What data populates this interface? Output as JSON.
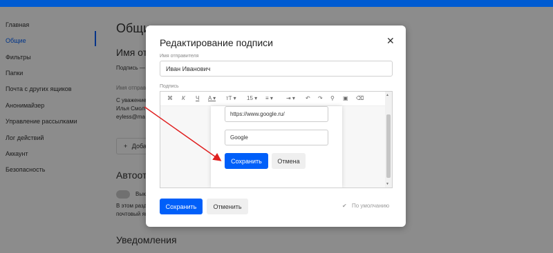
{
  "sidebar": {
    "items": [
      {
        "label": "Главная"
      },
      {
        "label": "Общие"
      },
      {
        "label": "Фильтры"
      },
      {
        "label": "Папки"
      },
      {
        "label": "Почта с других ящиков"
      },
      {
        "label": "Анонимайзер"
      },
      {
        "label": "Управление рассылками"
      },
      {
        "label": "Лог действий"
      },
      {
        "label": "Аккаунт"
      },
      {
        "label": "Безопасность"
      }
    ]
  },
  "main": {
    "title": "Общие",
    "section_name": "Имя отправителя",
    "signature_row": "Подпись —",
    "sender_label": "Имя отправителя",
    "signature_preview": [
      "С уважением,",
      "Илья Смол",
      "eyless@ma"
    ],
    "add_label": "Добавить",
    "autoreply_title": "Автоответ",
    "toggle_label": "Выкл",
    "autoreply_desc": [
      "В этом разделе",
      "почтовый ящик"
    ],
    "notifications_title": "Уведомления"
  },
  "modal": {
    "title": "Редактирование подписи",
    "close_glyph": "✕",
    "sender_name_label": "Имя отправителя",
    "sender_name_value": "Иван Иванович",
    "signature_label": "Подпись",
    "toolbar": {
      "font_size": "15"
    },
    "screenshot": {
      "url_value": "https://www.google.ru/",
      "text_value": "Google",
      "save_label": "Сохранить",
      "cancel_label": "Отмена"
    },
    "save_label": "Сохранить",
    "cancel_label": "Отменить",
    "default_label": "По умолчанию"
  },
  "colors": {
    "accent": "#005ff9",
    "annotation": "#e02020"
  }
}
